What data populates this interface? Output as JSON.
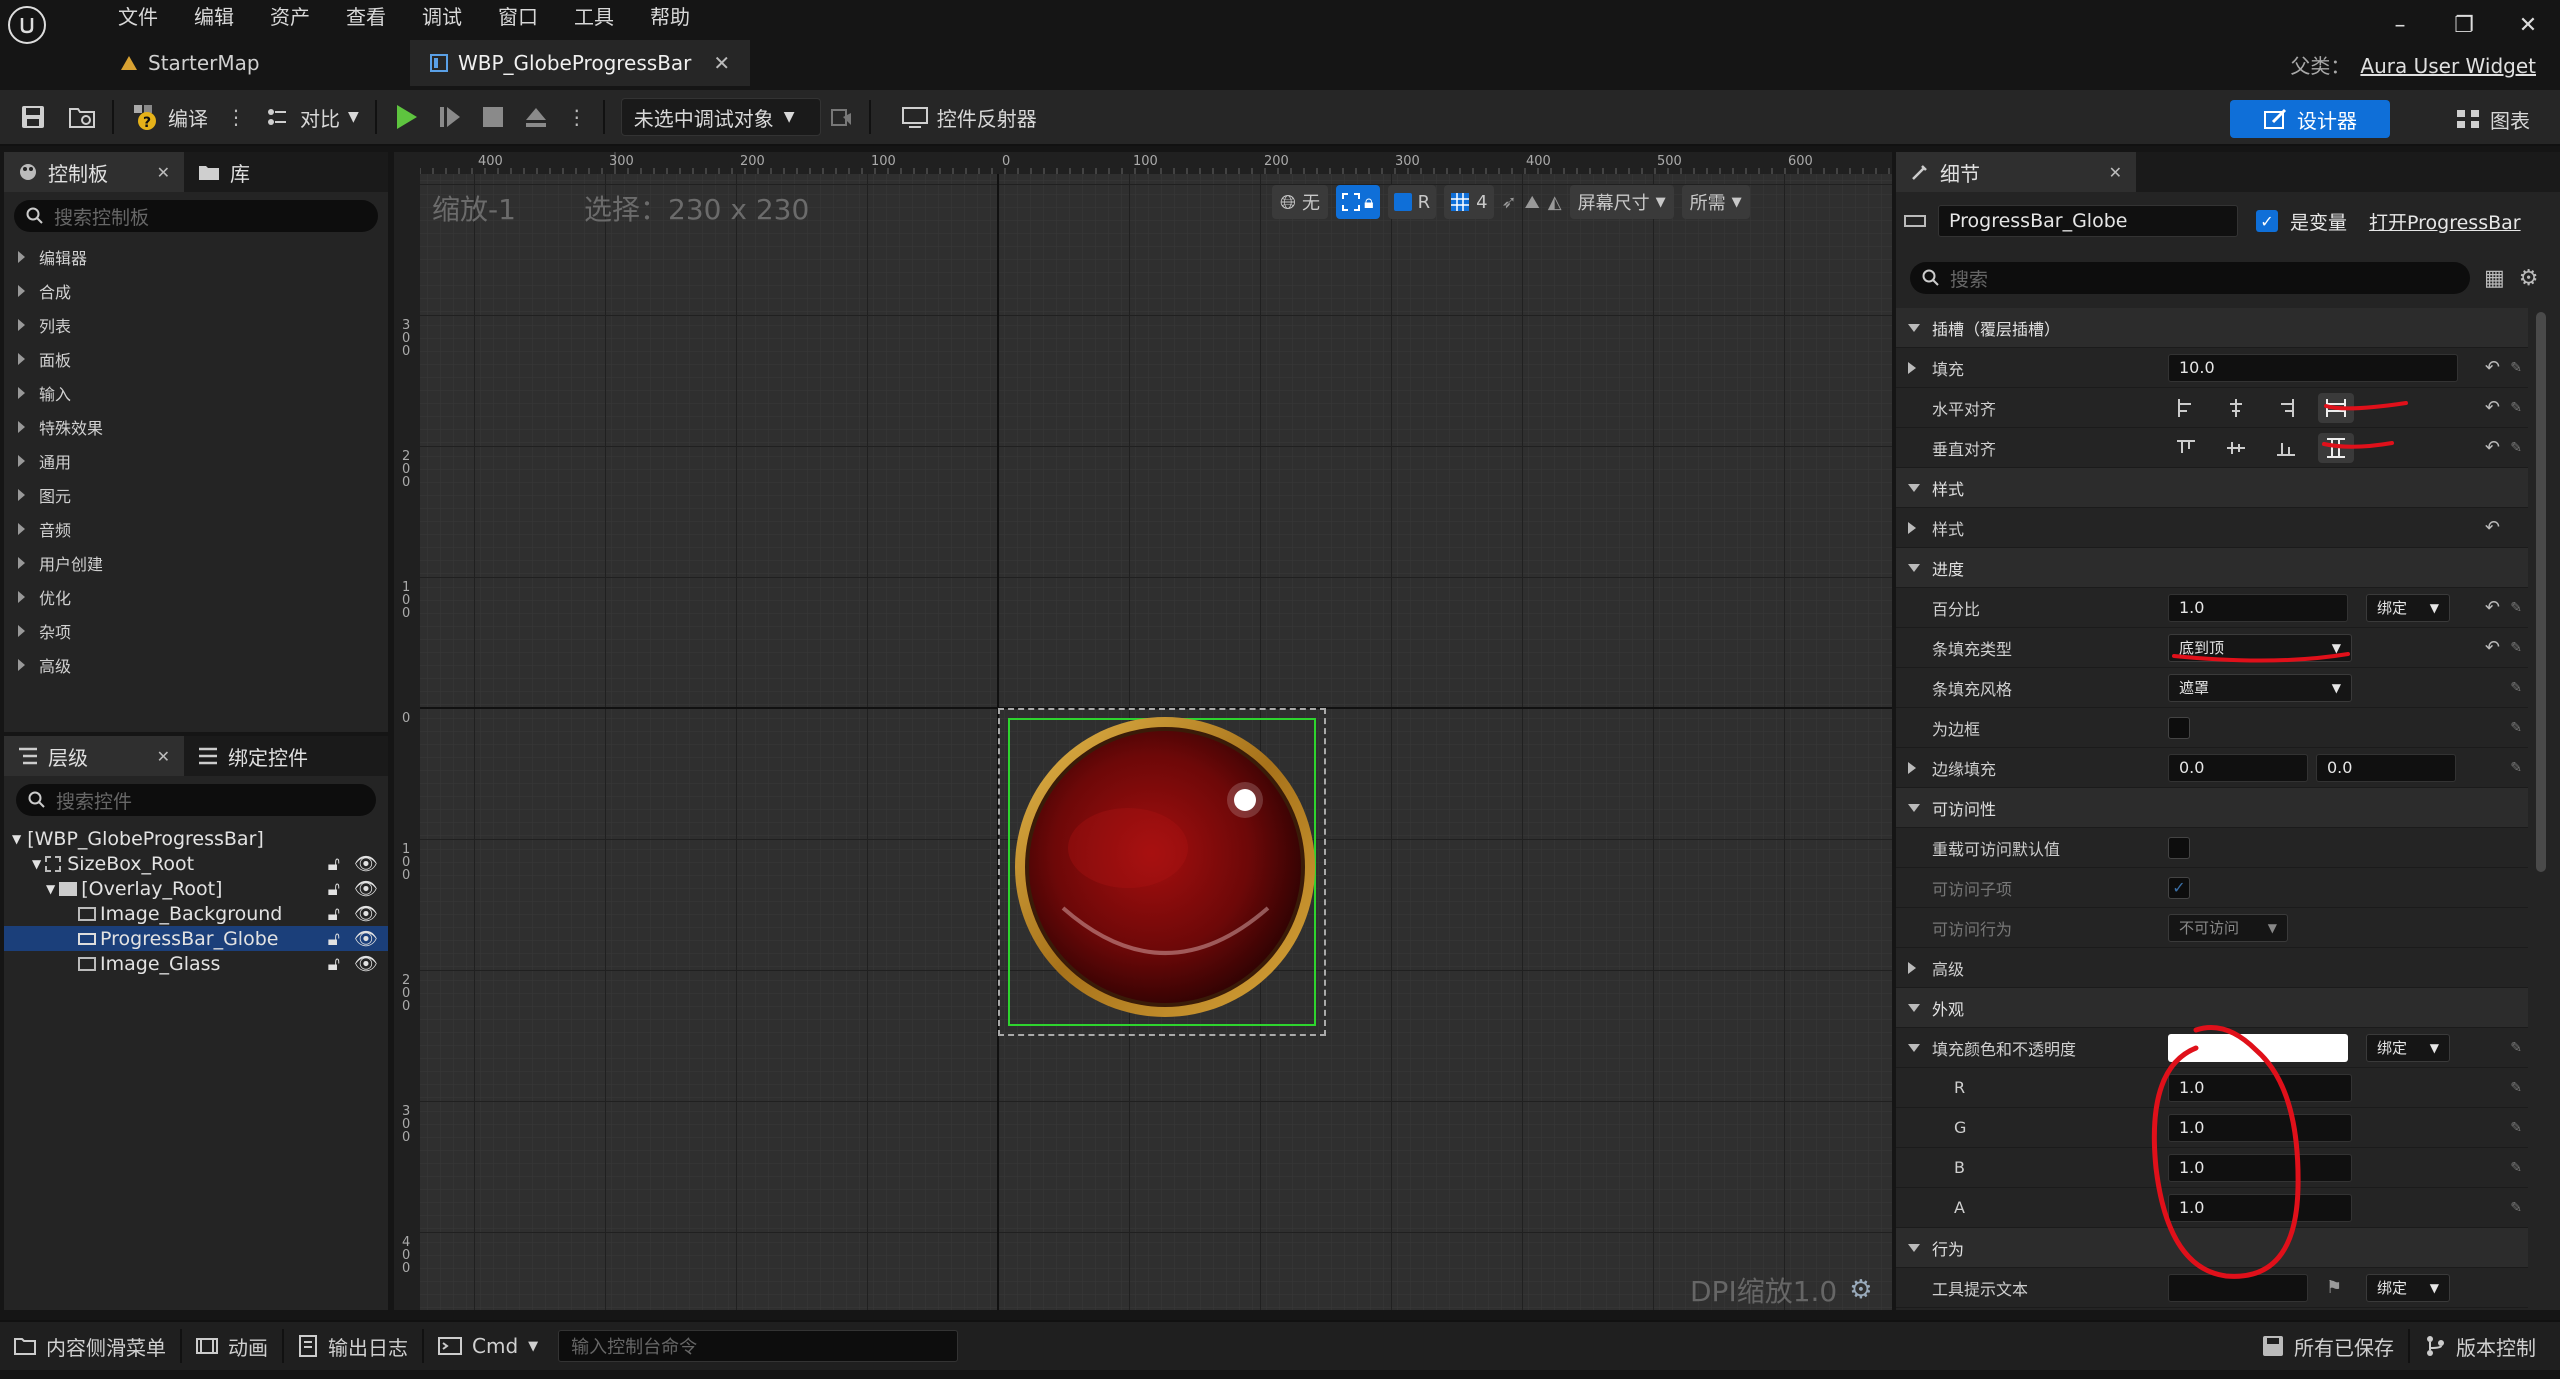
{
  "menu": [
    "文件",
    "编辑",
    "资产",
    "查看",
    "调试",
    "窗口",
    "工具",
    "帮助"
  ],
  "tabs": [
    {
      "label": "StarterMap"
    },
    {
      "label": "WBP_GlobeProgressBar"
    }
  ],
  "parent": {
    "label": "父类：",
    "value": "Aura User Widget"
  },
  "toolbar": {
    "compile": "编译",
    "diff": "对比",
    "debug_target": "未选中调试对象",
    "widget_reflector": "控件反射器",
    "designer": "设计器",
    "graph": "图表"
  },
  "palette": {
    "tab_label": "控制板",
    "library_label": "库",
    "search_placeholder": "搜索控制板",
    "categories": [
      "编辑器",
      "合成",
      "列表",
      "面板",
      "输入",
      "特殊效果",
      "通用",
      "图元",
      "音频",
      "用户创建",
      "优化",
      "杂项",
      "高级"
    ]
  },
  "hierarchy": {
    "tab_label": "层级",
    "bind_label": "绑定控件",
    "search_placeholder": "搜索控件",
    "items": [
      {
        "label": "[WBP_GlobeProgressBar]"
      },
      {
        "label": "SizeBox_Root"
      },
      {
        "label": "[Overlay_Root]"
      },
      {
        "label": "Image_Background"
      },
      {
        "label": "ProgressBar_Globe"
      },
      {
        "label": "Image_Glass"
      }
    ]
  },
  "viewport": {
    "zoom": "缩放-1",
    "selection": "选择：230 x 230",
    "none_label": "无",
    "r_label": "R",
    "grid_count": "4",
    "screen_size": "屏幕尺寸",
    "fill_mode": "所需",
    "dpi": "DPI缩放1.0",
    "ruler_top": [
      "400",
      "300",
      "200",
      "100",
      "0",
      "100",
      "200",
      "300",
      "400",
      "500",
      "600"
    ],
    "ruler_left": [
      "3\n0\n0",
      "2\n0\n0",
      "1\n0\n0",
      "0",
      "1\n0\n0",
      "2\n0\n0",
      "3\n0\n0",
      "4\n0\n0"
    ]
  },
  "details": {
    "tab_label": "细节",
    "widget_name": "ProgressBar_Globe",
    "is_variable": "是变量",
    "open_link": "打开ProgressBar",
    "search_placeholder": "搜索",
    "slot_section": "插槽（覆层插槽）",
    "padding_label": "填充",
    "padding_value": "10.0",
    "h_align": "水平对齐",
    "v_align": "垂直对齐",
    "style_section": "样式",
    "style_label": "样式",
    "progress_section": "进度",
    "percent_label": "百分比",
    "percent_value": "1.0",
    "bind_label": "绑定",
    "bar_fill_type": "条填充类型",
    "bar_fill_type_value": "底到顶",
    "bar_fill_style": "条填充风格",
    "bar_fill_style_value": "遮罩",
    "is_marquee": "为边框",
    "border_padding": "边缘填充",
    "border_padding_x": "0.0",
    "border_padding_y": "0.0",
    "access_section": "可访问性",
    "override_access": "重载可访问默认值",
    "access_children": "可访问子项",
    "access_behavior": "可访问行为",
    "access_behavior_value": "不可访问",
    "advanced": "高级",
    "appearance_section": "外观",
    "fill_color": "填充颜色和不透明度",
    "rgba": [
      {
        "ch": "R",
        "v": "1.0"
      },
      {
        "ch": "G",
        "v": "1.0"
      },
      {
        "ch": "B",
        "v": "1.0"
      },
      {
        "ch": "A",
        "v": "1.0"
      }
    ],
    "behavior_section": "行为",
    "tooltip_label": "工具提示文本"
  },
  "bottom": {
    "content_drawer": "内容侧滑菜单",
    "animation": "动画",
    "output_log": "输出日志",
    "cmd": "Cmd",
    "console_placeholder": "输入控制台命令",
    "all_saved": "所有已保存",
    "source_control": "版本控制"
  },
  "colors": {
    "accent": "#0f6fd8",
    "selection": "#1b3f7a",
    "annotation": "#e0101a",
    "globe_red": "#8a0c0c",
    "ring_gold": "#c9962a"
  }
}
